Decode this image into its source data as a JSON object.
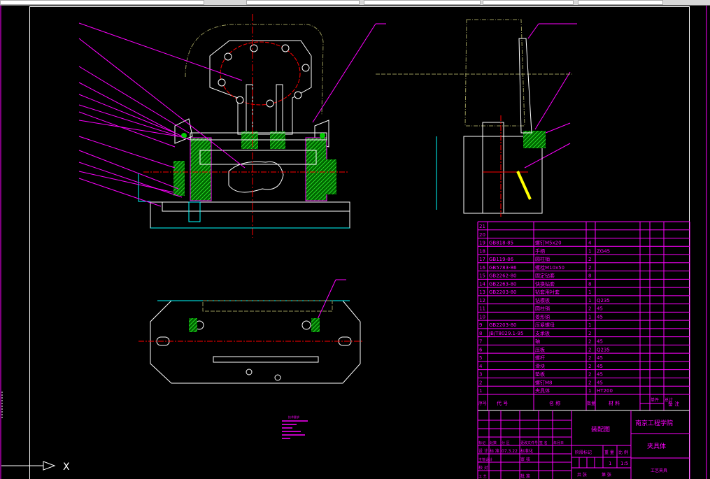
{
  "colors": {
    "background": "#000000",
    "frame": "#ffffff",
    "table": "#ff00ff",
    "outline": "#ffffff",
    "center": "#ff0000",
    "hatch": "#00cc00",
    "dimension": "#00ffff",
    "phantom": "#99995a",
    "leader": "#ff00ff"
  },
  "ucs": {
    "x_label": "X"
  },
  "bom": {
    "rows": [
      {
        "no": "21",
        "code": "",
        "name": "",
        "qty": "",
        "material": ""
      },
      {
        "no": "20",
        "code": "",
        "name": "",
        "qty": "",
        "material": ""
      },
      {
        "no": "19",
        "code": "GB818-85",
        "name": "螺钉M5x20",
        "qty": "4",
        "material": ""
      },
      {
        "no": "18",
        "code": "",
        "name": "手柄",
        "qty": "1",
        "material": "ZG45"
      },
      {
        "no": "17",
        "code": "GB119-86",
        "name": "圆柱销",
        "qty": "2",
        "material": ""
      },
      {
        "no": "16",
        "code": "GB5783-86",
        "name": "螺栓M10x50",
        "qty": "2",
        "material": ""
      },
      {
        "no": "15",
        "code": "GB2262-80",
        "name": "固定钻套",
        "qty": "8",
        "material": ""
      },
      {
        "no": "14",
        "code": "GB2263-80",
        "name": "快换钻套",
        "qty": "8",
        "material": ""
      },
      {
        "no": "13",
        "code": "GB2203-80",
        "name": "钻套用衬套",
        "qty": "1",
        "material": ""
      },
      {
        "no": "12",
        "code": "",
        "name": "钻模板",
        "qty": "1",
        "material": "Q235"
      },
      {
        "no": "11",
        "code": "",
        "name": "圆柱销",
        "qty": "2",
        "material": "45"
      },
      {
        "no": "10",
        "code": "",
        "name": "菱形销",
        "qty": "1",
        "material": "45"
      },
      {
        "no": "9",
        "code": "GB2203-80",
        "name": "压紧螺母",
        "qty": "1",
        "material": ""
      },
      {
        "no": "8",
        "code": "JB/T8029.1-95",
        "name": "支承板",
        "qty": "2",
        "material": ""
      },
      {
        "no": "7",
        "code": "",
        "name": "轴",
        "qty": "2",
        "material": "45"
      },
      {
        "no": "6",
        "code": "",
        "name": "压板",
        "qty": "2",
        "material": "Q235"
      },
      {
        "no": "5",
        "code": "",
        "name": "螺杆",
        "qty": "2",
        "material": "45"
      },
      {
        "no": "4",
        "code": "",
        "name": "滑块",
        "qty": "2",
        "material": "45"
      },
      {
        "no": "3",
        "code": "",
        "name": "垫板",
        "qty": "2",
        "material": "45"
      },
      {
        "no": "2",
        "code": "",
        "name": "螺钉M8",
        "qty": "2",
        "material": "45"
      },
      {
        "no": "1",
        "code": "",
        "name": "夹具体",
        "qty": "1",
        "material": "HT200"
      }
    ],
    "headers": {
      "no": "序号",
      "code": "代 号",
      "name": "名 称",
      "qty": "数量",
      "material": "材 料",
      "unit": "单件",
      "total": "总计",
      "weight_note": "重量",
      "remark": "备 注"
    }
  },
  "title_block": {
    "drawing_name": "装配图",
    "school": "南京工程学院",
    "part_name": "夹具体",
    "part_note": "工艺夹具",
    "stage_mark": "阶段标记",
    "weight": "重 量",
    "scale": "比 例",
    "qty_value": "1",
    "scale_value": "1:5",
    "sheets": "共 张",
    "sheet_no": "第 张",
    "rev_headers": [
      "标记",
      "处数",
      "分 区",
      "更改文件号",
      "签 名",
      "年月日"
    ],
    "design": "设 计",
    "standard": "标 准",
    "design_date": "07.3.22",
    "standardize": "标准化",
    "chief": "主管设计",
    "review": "审 核",
    "check": "校 对",
    "process": "工 艺",
    "approve": "批 准"
  },
  "notes": {
    "title": "技术要求"
  }
}
